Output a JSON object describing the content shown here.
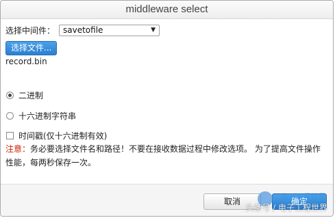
{
  "window": {
    "title": "middleware select"
  },
  "middleware": {
    "label": "选择中间件：",
    "selected": "savetofile"
  },
  "file": {
    "button_label": "选择文件...",
    "filename": "record.bin"
  },
  "options": {
    "binary_label": "二进制",
    "binary_checked": true,
    "hex_label": "十六进制字符串",
    "hex_checked": false,
    "timestamp_label": "时间戳(仅十六进制有效)",
    "timestamp_checked": false
  },
  "note": {
    "prefix": "注意：",
    "text": "务必要选择文件名和路径！不要在接收数据过程中修改选项。 为了提高文件操作性能，每两秒保存一次。"
  },
  "footer": {
    "cancel_label": "取消",
    "ok_label": "确定"
  },
  "watermark": {
    "text": "头条号 / 电子工程世界",
    "logo_text": "电子工程世界"
  },
  "colors": {
    "accent": "#2b7fd0",
    "warning": "#cc2200"
  }
}
